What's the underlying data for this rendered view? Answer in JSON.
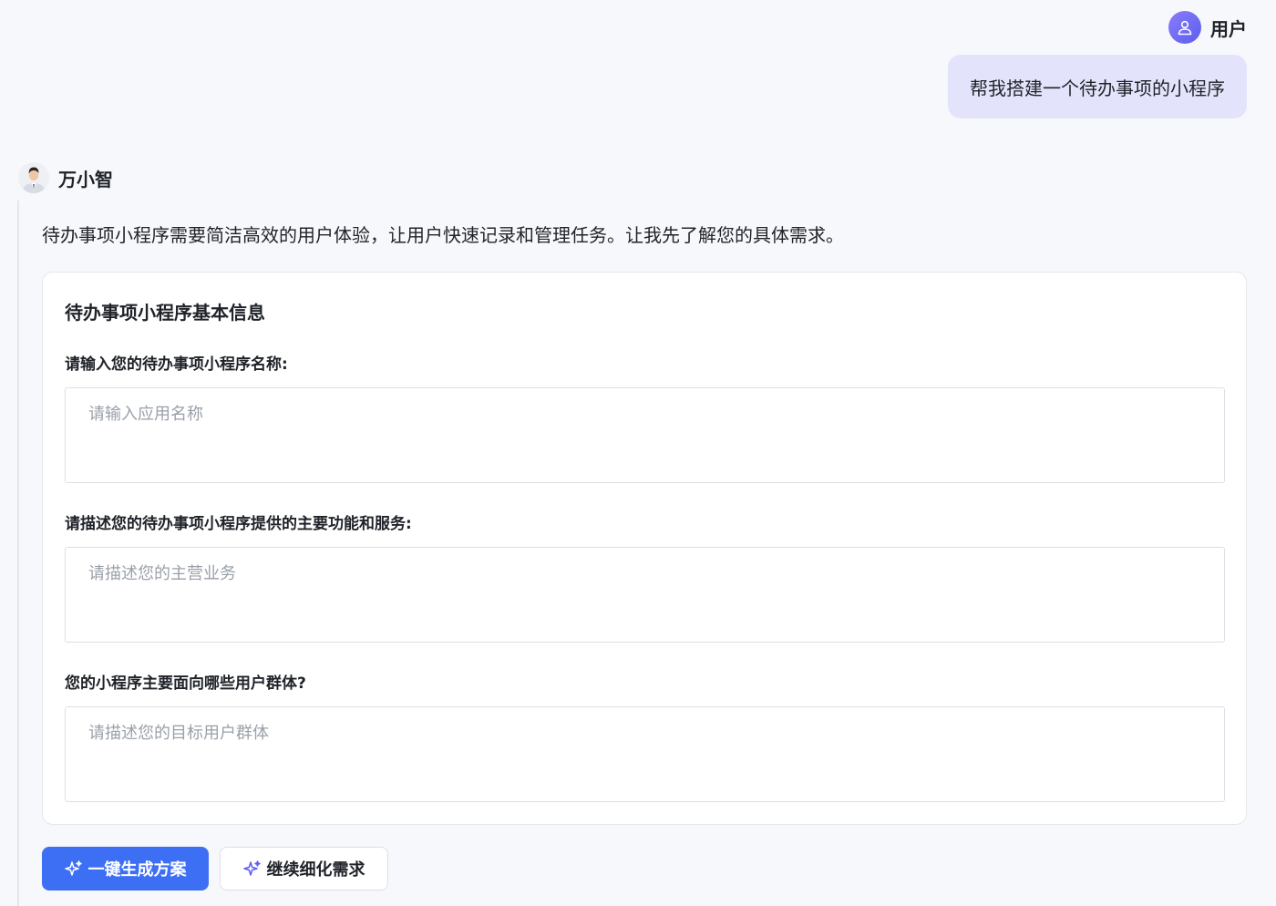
{
  "user": {
    "name": "用户",
    "message": "帮我搭建一个待办事项的小程序"
  },
  "assistant": {
    "name": "万小智",
    "intro": "待办事项小程序需要简洁高效的用户体验，让用户快速记录和管理任务。让我先了解您的具体需求。"
  },
  "form": {
    "title": "待办事项小程序基本信息",
    "fields": [
      {
        "label": "请输入您的待办事项小程序名称:",
        "placeholder": "请输入应用名称",
        "value": ""
      },
      {
        "label": "请描述您的待办事项小程序提供的主要功能和服务:",
        "placeholder": "请描述您的主营业务",
        "value": ""
      },
      {
        "label": "您的小程序主要面向哪些用户群体?",
        "placeholder": "请描述您的目标用户群体",
        "value": ""
      }
    ]
  },
  "actions": {
    "primary_label": "一键生成方案",
    "secondary_label": "继续细化需求"
  },
  "icons": {
    "user_avatar": "user-icon",
    "assistant_avatar": "person-photo-avatar",
    "primary_button": "sparkle-icon",
    "secondary_button": "sparkle-icon"
  },
  "colors": {
    "accent": "#3d6ff5",
    "user_bubble": "#e3e4fb",
    "avatar_gradient_start": "#8a7cf8",
    "avatar_gradient_end": "#5b5ef0",
    "secondary_icon": "#5b5ef0"
  }
}
